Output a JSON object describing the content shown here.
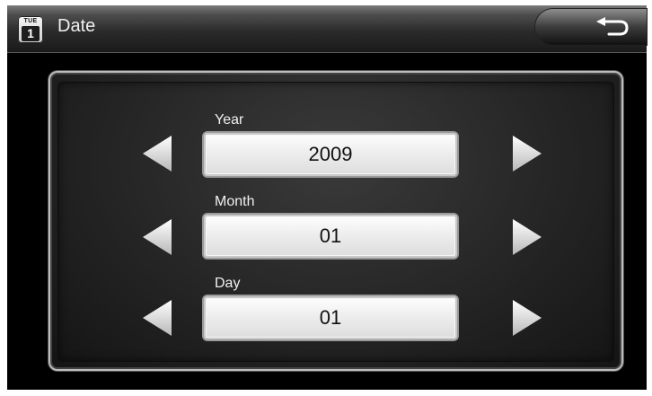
{
  "header": {
    "calendar_icon": {
      "day": "TUE",
      "date": "1"
    },
    "title": "Date",
    "back_button_icon": "return-arrow-icon"
  },
  "fields": [
    {
      "label": "Year",
      "value": "2009"
    },
    {
      "label": "Month",
      "value": "01"
    },
    {
      "label": "Day",
      "value": "01"
    }
  ],
  "colors": {
    "background": "#000000",
    "value_box": "#e8e8e8",
    "arrow": "#e0e0e0",
    "text": "#ffffff"
  }
}
